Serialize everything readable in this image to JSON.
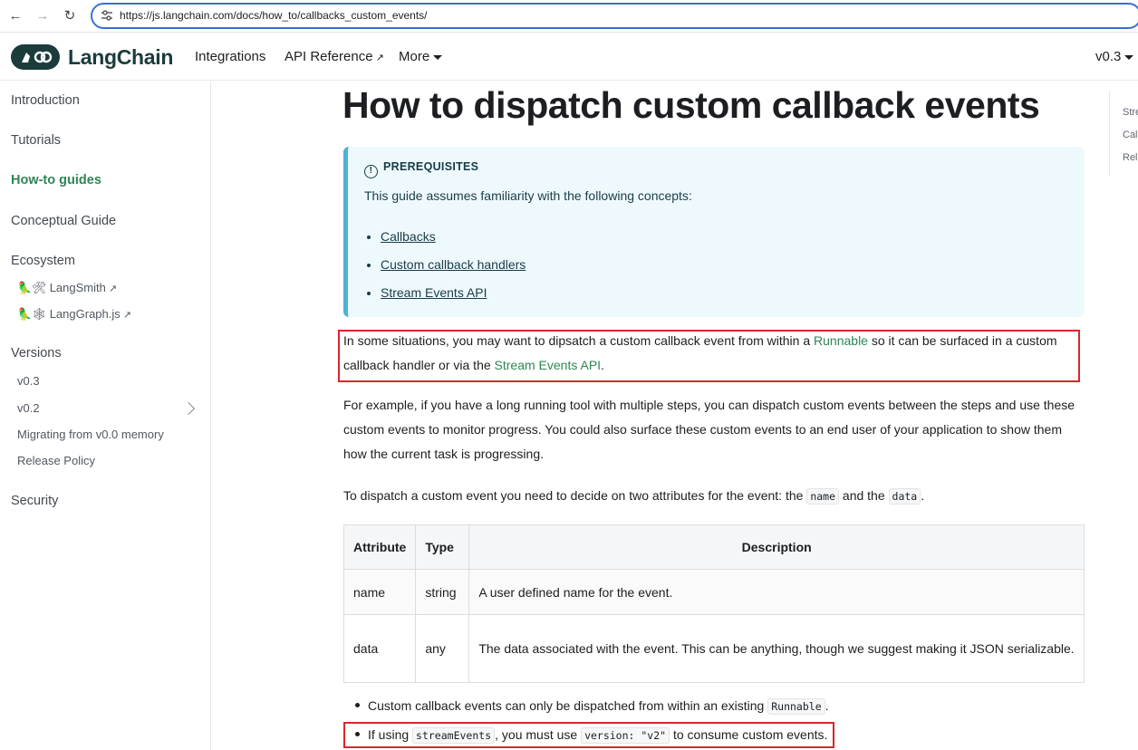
{
  "browser": {
    "url": "https://js.langchain.com/docs/how_to/callbacks_custom_events/"
  },
  "navbar": {
    "brand": "LangChain",
    "links": [
      "Integrations",
      "API Reference",
      "More"
    ],
    "version": "v0.3"
  },
  "sidebar": {
    "introduction": "Introduction",
    "tutorials": "Tutorials",
    "howto": "How-to guides",
    "conceptual": "Conceptual Guide",
    "ecosystem": "Ecosystem",
    "langsmith": "LangSmith",
    "langgraph": "LangGraph.js",
    "versions": "Versions",
    "v03": "v0.3",
    "v02": "v0.2",
    "migrating": "Migrating from v0.0 memory",
    "release": "Release Policy",
    "security": "Security"
  },
  "toc": [
    "Stre",
    "Call",
    "Rela"
  ],
  "page": {
    "title": "How to dispatch custom callback events",
    "prereq_header": "PREREQUISITES",
    "prereq_desc": "This guide assumes familiarity with the following concepts:",
    "prereq_items": [
      "Callbacks",
      "Custom callback handlers",
      "Stream Events API"
    ],
    "p1_a": "In some situations, you may want to dipsatch a custom callback event from within a ",
    "p1_link1": "Runnable",
    "p1_b": " so it can be surfaced in a custom callback handler or via the ",
    "p1_link2": "Stream Events API",
    "p1_c": ".",
    "p2": "For example, if you have a long running tool with multiple steps, you can dispatch custom events between the steps and use these custom events to monitor progress. You could also surface these custom events to an end user of your application to show them how the current task is progressing.",
    "p3_a": "To dispatch a custom event you need to decide on two attributes for the event: the ",
    "p3_code1": "name",
    "p3_b": " and the ",
    "p3_code2": "data",
    "p3_c": ".",
    "table": {
      "headers": [
        "Attribute",
        "Type",
        "Description"
      ],
      "rows": [
        [
          "name",
          "string",
          "A user defined name for the event."
        ],
        [
          "data",
          "any",
          "The data associated with the event. This can be anything, though we suggest making it JSON serializable."
        ]
      ]
    },
    "b1_a": "Custom callback events can only be dispatched from within an existing ",
    "b1_code": "Runnable",
    "b1_b": ".",
    "b2_a": "If using ",
    "b2_code1": "streamEvents",
    "b2_b": ", you must use ",
    "b2_code2": "version: \"v2\"",
    "b2_c": " to consume custom events."
  },
  "colors": {
    "accent": "#2e8555",
    "highlight": "#d9262c",
    "admonition": "#4cb3d4"
  }
}
